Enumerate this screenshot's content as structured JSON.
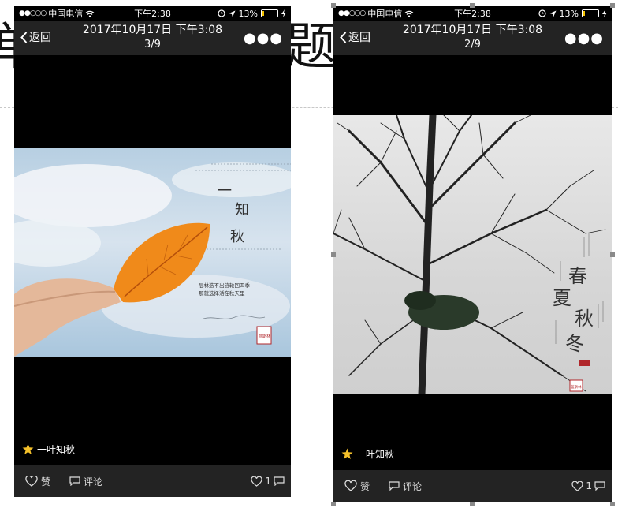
{
  "background": {
    "title_left": "单",
    "title_right": "题"
  },
  "screens": [
    {
      "status": {
        "signal": "●●○○○",
        "carrier": "中国电信",
        "time": "下午2:38",
        "battery": "13%",
        "battery_level": 0.13
      },
      "nav": {
        "back": "返回",
        "date": "2017年10月17日 下午3:08",
        "count": "3/9"
      },
      "photo": {
        "poem": [
          "一",
          "知",
          "秋"
        ],
        "lines": [
          "层林迭不出涟轮回四季",
          "那就选择活在秋天里"
        ],
        "seal": "蓝斯林"
      },
      "caption": "一叶知秋",
      "toolbar": {
        "like": "赞",
        "comment": "评论",
        "likes_count": "1"
      }
    },
    {
      "status": {
        "signal": "●●○○○",
        "carrier": "中国电信",
        "time": "下午2:38",
        "battery": "13%",
        "battery_level": 0.13
      },
      "nav": {
        "back": "返回",
        "date": "2017年10月17日 下午3:08",
        "count": "2/9"
      },
      "photo": {
        "poem": [
          "春",
          "夏",
          "秋",
          "冬"
        ],
        "seal": "蓝斯林"
      },
      "caption": "一叶知秋",
      "toolbar": {
        "like": "赞",
        "comment": "评论",
        "likes_count": "1"
      }
    }
  ],
  "colors": {
    "battery": "#f5c400",
    "bar": "#232323",
    "leaf": "#f08a1a",
    "seal": "#b0262a"
  },
  "icons": [
    "wifi-icon",
    "location-icon",
    "alarm-icon",
    "charging-icon",
    "back-chevron-icon",
    "more-icon",
    "star-icon",
    "heart-icon",
    "comment-icon"
  ]
}
